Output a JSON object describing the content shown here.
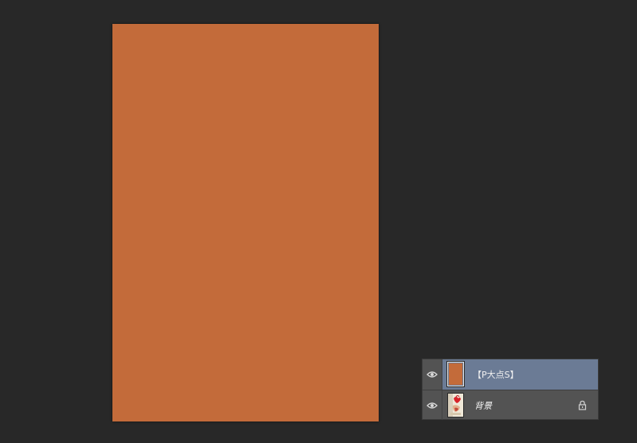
{
  "colors": {
    "workspace_bg": "#282828",
    "document_fill": "#c36b3a",
    "panel_bg": "#535353",
    "selected_layer_bg": "#6b7b95"
  },
  "canvas": {
    "fill_color": "#c36b3a"
  },
  "layers": {
    "items": [
      {
        "name": "【P大点S】",
        "selected": true,
        "visible": true,
        "thumbnail_color": "#c36b3a",
        "eye_icon": "eye-icon"
      },
      {
        "name": "背景",
        "selected": false,
        "visible": true,
        "locked": true,
        "eye_icon": "eye-icon",
        "lock_icon": "lock-icon"
      }
    ]
  }
}
